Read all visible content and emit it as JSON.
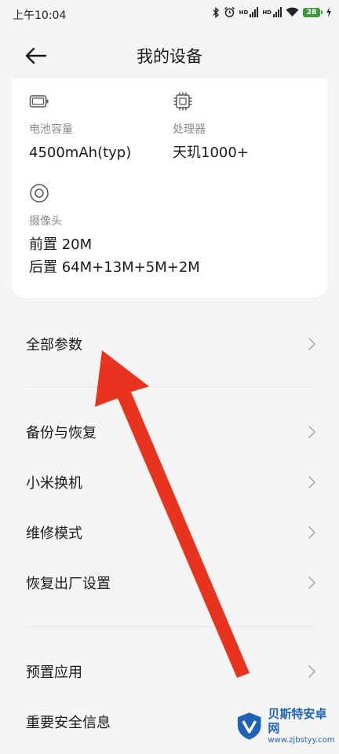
{
  "status_bar": {
    "time": "上午10:04",
    "network_1": "HD",
    "network_2": "HD",
    "battery_level": "28"
  },
  "header": {
    "title": "我的设备"
  },
  "specs": {
    "battery": {
      "label": "电池容量",
      "value": "4500mAh(typ)"
    },
    "processor": {
      "label": "处理器",
      "value": "天玑1000+"
    },
    "camera": {
      "label": "摄像头",
      "front": "前置 20M",
      "rear": "后置 64M+13M+5M+2M"
    }
  },
  "menu": {
    "all_params": "全部参数",
    "backup_restore": "备份与恢复",
    "mi_mover": "小米换机",
    "repair_mode": "维修模式",
    "factory_reset": "恢复出厂设置",
    "preinstalled_apps": "预置应用",
    "safety_info": "重要安全信息"
  },
  "watermark": {
    "title": "贝斯特安卓网",
    "url": "www.zjbstyy.com"
  },
  "colors": {
    "annotation_arrow": "#e8331e",
    "battery_fill": "#3c9a3c",
    "watermark_blue": "#1f63b8"
  }
}
